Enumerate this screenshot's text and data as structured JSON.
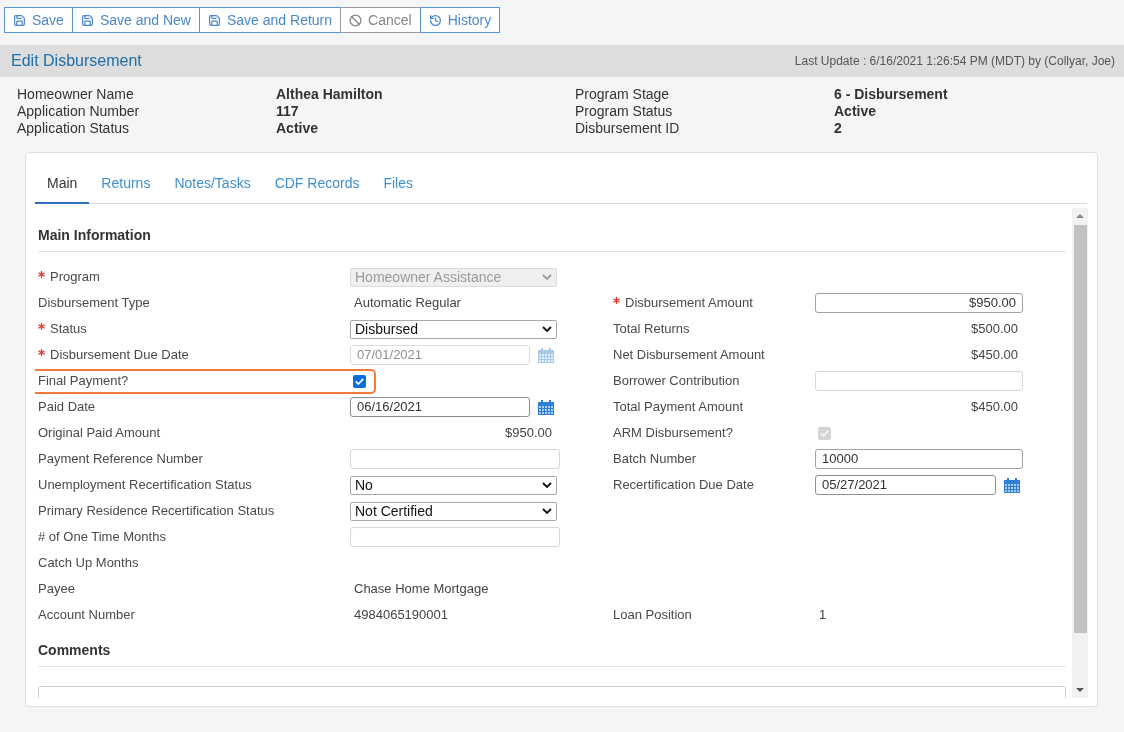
{
  "toolbar": {
    "buttons": [
      {
        "label": "Save",
        "kind": "save"
      },
      {
        "label": "Save and New",
        "kind": "save"
      },
      {
        "label": "Save and Return",
        "kind": "save"
      },
      {
        "label": "Cancel",
        "kind": "cancel"
      },
      {
        "label": "History",
        "kind": "history"
      }
    ]
  },
  "header": {
    "title": "Edit Disbursement",
    "last_update": "Last Update : 6/16/2021 1:26:54 PM (MDT) by (Collyar, Joe)"
  },
  "summary": {
    "left": [
      {
        "label": "Homeowner Name",
        "value": "Althea Hamilton"
      },
      {
        "label": "Application Number",
        "value": "117"
      },
      {
        "label": "Application Status",
        "value": "Active"
      }
    ],
    "right": [
      {
        "label": "Program Stage",
        "value": "6 - Disbursement"
      },
      {
        "label": "Program Status",
        "value": "Active"
      },
      {
        "label": "Disbursement ID",
        "value": "2"
      }
    ]
  },
  "tabs": [
    {
      "label": "Main",
      "selected": true
    },
    {
      "label": "Returns",
      "selected": false
    },
    {
      "label": "Notes/Tasks",
      "selected": false
    },
    {
      "label": "CDF Records",
      "selected": false
    },
    {
      "label": "Files",
      "selected": false
    }
  ],
  "main_information": {
    "title": "Main Information",
    "rows": [
      {
        "left": {
          "label": "Program",
          "required": true,
          "highlighted": false,
          "kind": "select",
          "value": "Homeowner Assistance",
          "disabled": true
        }
      },
      {
        "left": {
          "label": "Disbursement Type",
          "required": false,
          "highlighted": false,
          "kind": "text",
          "value": "Automatic Regular"
        },
        "right": {
          "label": "Disbursement Amount",
          "required": true,
          "highlighted": false,
          "kind": "money_input",
          "value": "$950.00",
          "disabled": false
        }
      },
      {
        "left": {
          "label": "Status",
          "required": true,
          "highlighted": false,
          "kind": "select",
          "value": "Disbursed",
          "disabled": false
        },
        "right": {
          "label": "Total Returns",
          "required": false,
          "highlighted": false,
          "kind": "amount",
          "value": "$500.00"
        }
      },
      {
        "left": {
          "label": "Disbursement Due Date",
          "required": true,
          "highlighted": false,
          "kind": "date",
          "value": "07/01/2021",
          "disabled": true
        },
        "right": {
          "label": "Net Disbursement Amount",
          "required": false,
          "highlighted": false,
          "kind": "amount",
          "value": "$450.00"
        }
      },
      {
        "left": {
          "label": "Final Payment?",
          "required": false,
          "highlighted": true,
          "kind": "checkbox",
          "checked": true,
          "disabled": false
        },
        "right": {
          "label": "Borrower Contribution",
          "required": false,
          "highlighted": false,
          "kind": "input",
          "disabled": false
        }
      },
      {
        "left": {
          "label": "Paid Date",
          "required": false,
          "highlighted": false,
          "kind": "date",
          "value": "06/16/2021",
          "disabled": false
        },
        "right": {
          "label": "Total Payment Amount",
          "required": false,
          "highlighted": false,
          "kind": "amount",
          "value": "$450.00"
        }
      },
      {
        "left": {
          "label": "Original Paid Amount",
          "required": false,
          "highlighted": false,
          "kind": "amount",
          "value": "$950.00"
        },
        "right": {
          "label": "ARM Disbursement?",
          "required": false,
          "highlighted": false,
          "kind": "checkbox",
          "checked": true,
          "disabled": true
        }
      },
      {
        "left": {
          "label": "Payment Reference Number",
          "required": false,
          "highlighted": false,
          "kind": "input",
          "disabled": false
        },
        "right": {
          "label": "Batch Number",
          "required": false,
          "highlighted": false,
          "kind": "input",
          "value": "10000",
          "disabled": false
        }
      },
      {
        "left": {
          "label": "Unemployment Recertification Status",
          "required": false,
          "highlighted": false,
          "kind": "select",
          "value": "No",
          "disabled": false
        },
        "right": {
          "label": "Recertification Due Date",
          "required": false,
          "highlighted": false,
          "kind": "date",
          "value": "05/27/2021",
          "disabled": false
        }
      },
      {
        "left": {
          "label": "Primary Residence Recertification Status",
          "required": false,
          "highlighted": false,
          "kind": "select",
          "value": "Not Certified",
          "disabled": false
        }
      },
      {
        "left": {
          "label": "# of One Time Months",
          "required": false,
          "highlighted": false,
          "kind": "input",
          "disabled": false
        }
      },
      {
        "left": {
          "label": "Catch Up Months",
          "required": false,
          "highlighted": false,
          "kind": "text"
        }
      },
      {
        "left": {
          "label": "Payee",
          "required": false,
          "highlighted": false,
          "kind": "text",
          "value": "Chase Home Mortgage"
        }
      },
      {
        "left": {
          "label": "Account Number",
          "required": false,
          "highlighted": false,
          "kind": "text",
          "value": "4984065190001"
        },
        "right": {
          "label": "Loan Position",
          "required": false,
          "highlighted": false,
          "kind": "text",
          "value": "1"
        }
      }
    ]
  },
  "comments": {
    "title": "Comments"
  }
}
